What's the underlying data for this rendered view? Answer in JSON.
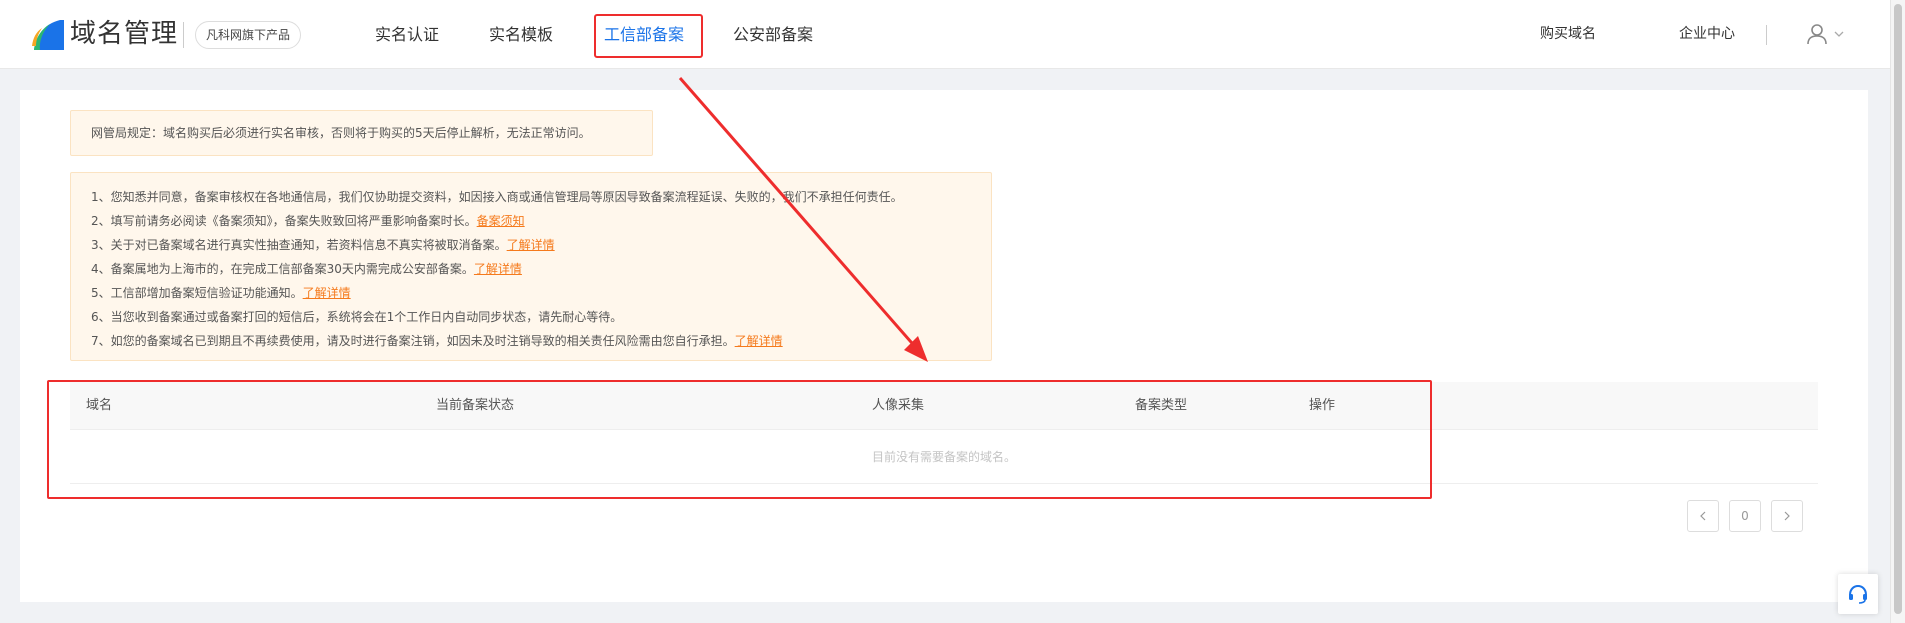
{
  "header": {
    "logo_text": "域名管理",
    "brand_badge": "凡科网旗下产品",
    "nav": [
      {
        "label": "实名认证"
      },
      {
        "label": "实名模板"
      },
      {
        "label": "工信部备案"
      },
      {
        "label": "公安部备案"
      }
    ],
    "right_links": [
      {
        "label": "购买域名"
      },
      {
        "label": "企业中心"
      }
    ]
  },
  "notice_top": "网管局规定：域名购买后必须进行实名审核，否则将于购买的5天后停止解析，无法正常访问。",
  "notices": [
    {
      "text": "1、您知悉并同意，备案审核权在各地通信局，我们仅协助提交资料，如因接入商或通信管理局等原因导致备案流程延误、失败的，我们不承担任何责任。",
      "link": ""
    },
    {
      "text": "2、填写前请务必阅读《备案须知》，备案失败致回将严重影响备案时长。",
      "link": "备案须知"
    },
    {
      "text": "3、关于对已备案域名进行真实性抽查通知，若资料信息不真实将被取消备案。",
      "link": "了解详情"
    },
    {
      "text": "4、备案属地为上海市的，在完成工信部备案30天内需完成公安部备案。",
      "link": "了解详情"
    },
    {
      "text": "5、工信部增加备案短信验证功能通知。",
      "link": "了解详情"
    },
    {
      "text": "6、当您收到备案通过或备案打回的短信后，系统将会在1个工作日内自动同步状态，请先耐心等待。",
      "link": ""
    },
    {
      "text": "7、如您的备案域名已到期且不再续费使用，请及时进行备案注销，如因未及时注销导致的相关责任风险需由您自行承担。",
      "link": "了解详情"
    }
  ],
  "table": {
    "columns": [
      "域名",
      "当前备案状态",
      "人像采集",
      "备案类型",
      "操作"
    ],
    "empty_text": "目前没有需要备案的域名。"
  },
  "pagination": {
    "prev": "<",
    "page": "0",
    "next": ">"
  },
  "colors": {
    "accent": "#1a73e8",
    "annotation_red": "#ee2d2d",
    "link_orange": "#f57a1c"
  }
}
